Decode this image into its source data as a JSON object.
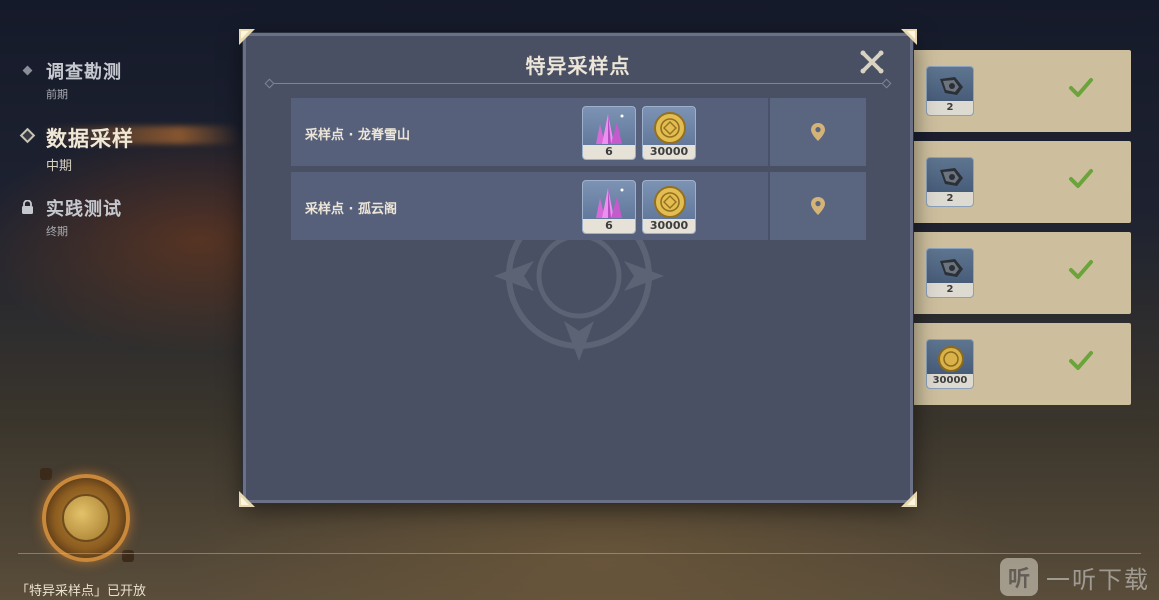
{
  "nav": {
    "items": [
      {
        "title": "调查勘测",
        "subtitle": "前期",
        "state": "done"
      },
      {
        "title": "数据采样",
        "subtitle": "中期",
        "state": "active"
      },
      {
        "title": "实践测试",
        "subtitle": "终期",
        "state": "locked"
      }
    ]
  },
  "footer": {
    "notice": "「特异采样点」已开放"
  },
  "rewards": [
    {
      "icon": "gear-material-icon",
      "qty": "2",
      "claimed": true
    },
    {
      "icon": "gear-material-icon",
      "qty": "2",
      "claimed": true
    },
    {
      "icon": "gear-material-icon",
      "qty": "2",
      "claimed": true
    },
    {
      "icon": "mora-coin-icon",
      "qty": "30000",
      "claimed": true
    }
  ],
  "modal": {
    "title": "特异采样点",
    "sites": [
      {
        "name": "采样点 · 龙脊雪山",
        "items": [
          {
            "icon": "crystal-icon",
            "qty": "6"
          },
          {
            "icon": "mora-coin-icon",
            "qty": "30000"
          }
        ]
      },
      {
        "name": "采样点 · 孤云阁",
        "items": [
          {
            "icon": "crystal-icon",
            "qty": "6"
          },
          {
            "icon": "mora-coin-icon",
            "qty": "30000"
          }
        ]
      }
    ]
  },
  "brand": {
    "logo": "听",
    "name": "一听下载"
  },
  "colors": {
    "accent_gold": "#d4b378",
    "check_green": "#6aa43a",
    "modal_bg": "#495063"
  }
}
